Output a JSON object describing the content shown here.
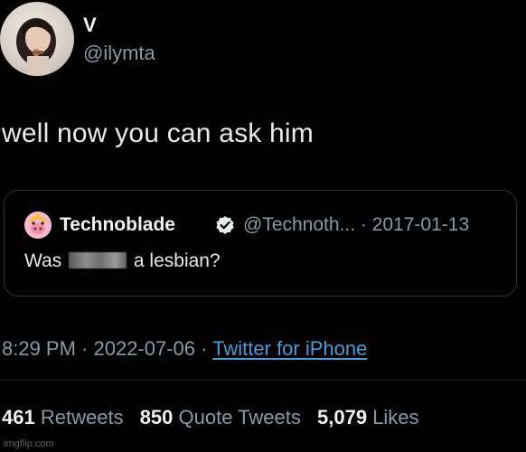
{
  "author": {
    "display_name": "V",
    "handle": "@ilymta"
  },
  "tweet": {
    "text": "well now you can ask him"
  },
  "quoted_tweet": {
    "display_name": "Technoblade",
    "handle_date": "@Technoth... · 2017-01-13",
    "text_before": "Was",
    "text_after": "a lesbian?"
  },
  "meta": {
    "time_date": "8:29 PM · 2022-07-06 · ",
    "source": "Twitter for iPhone"
  },
  "stats": {
    "retweets_count": "461",
    "retweets_label": "Retweets",
    "quote_count": "850",
    "quote_label": "Quote Tweets",
    "likes_count": "5,079",
    "likes_label": "Likes"
  },
  "watermark": "imgflip.com",
  "colors": {
    "background": "#000000",
    "text": "#e7e9ea",
    "muted": "#8b98a5",
    "link": "#4a9bd6",
    "verified": "#1d9bf0"
  },
  "icons": {
    "verified": "verified-badge-icon"
  }
}
